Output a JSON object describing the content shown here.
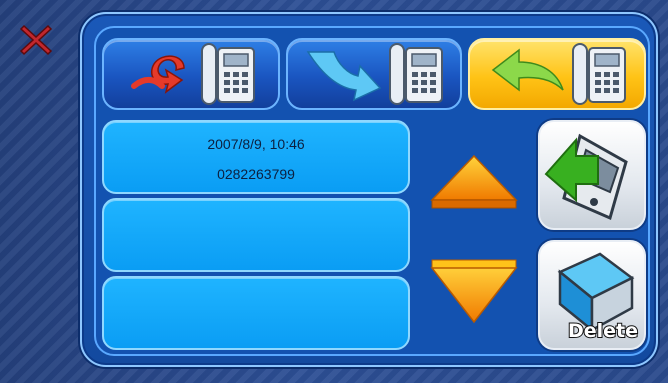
{
  "tabs": [
    {
      "id": "missed",
      "icon": "missed-call-icon",
      "active": false
    },
    {
      "id": "received",
      "icon": "received-call-icon",
      "active": false
    },
    {
      "id": "dialed",
      "icon": "dialed-call-icon",
      "active": true
    }
  ],
  "call_log": [
    {
      "datetime": "2007/8/9, 10:46",
      "number": "0282263799"
    },
    {
      "datetime": "",
      "number": ""
    },
    {
      "datetime": "",
      "number": ""
    }
  ],
  "actions": {
    "call_back_icon": "call-back-phone-icon",
    "delete_label": "Delete"
  },
  "colors": {
    "accent_active": "#ffc316",
    "entry_fill": "#0a9df4",
    "close_red": "#c2272d"
  }
}
